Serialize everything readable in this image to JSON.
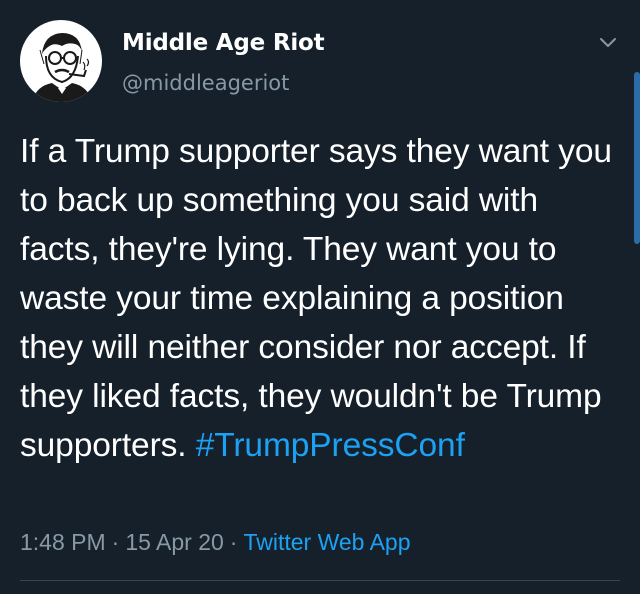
{
  "author": {
    "display_name": "Middle Age Riot",
    "handle": "@middleageriot",
    "avatar_icon": "sketch-portrait-avatar"
  },
  "tweet": {
    "text_before_hashtag": "If a Trump supporter says they want you to back up something you said with facts, they're lying. They want you to waste your time explaining a position they will neither consider nor accept. If they liked facts, they wouldn't be Trump supporters.",
    "hashtag": "#TrumpPressConf"
  },
  "meta": {
    "time": "1:48 PM",
    "separator": "·",
    "date": "15 Apr 20",
    "source": "Twitter Web App"
  },
  "icons": {
    "more_menu": "chevron-down-icon"
  },
  "colors": {
    "background": "#15202b",
    "link": "#1da1f2",
    "secondary_text": "#8899a6",
    "primary_text": "#ffffff"
  }
}
